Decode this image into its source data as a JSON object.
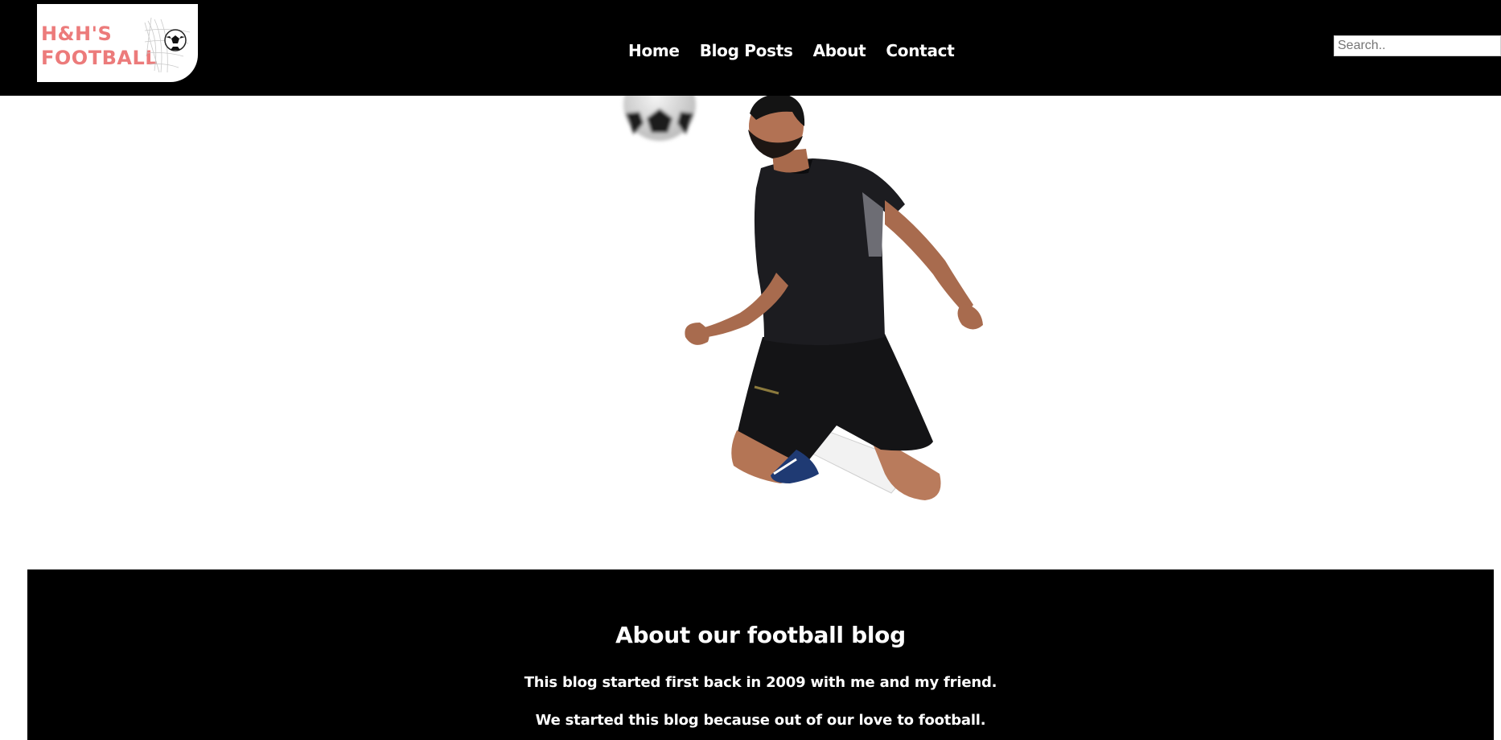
{
  "header": {
    "logo": {
      "line1": "H&H'S",
      "line2": "FOOTBALL",
      "icon": "soccer-ball-net-icon",
      "color": "#ec7b7b"
    },
    "nav": [
      {
        "label": "Home"
      },
      {
        "label": "Blog Posts"
      },
      {
        "label": "About"
      },
      {
        "label": "Contact"
      }
    ],
    "search": {
      "placeholder": "Search..",
      "value": ""
    }
  },
  "hero": {
    "image": "football-player-heading-ball"
  },
  "about": {
    "title": "About our football blog",
    "paragraphs": [
      "This blog started first back in 2009 with me and my friend.",
      "We started this blog because out of our love to football."
    ]
  }
}
